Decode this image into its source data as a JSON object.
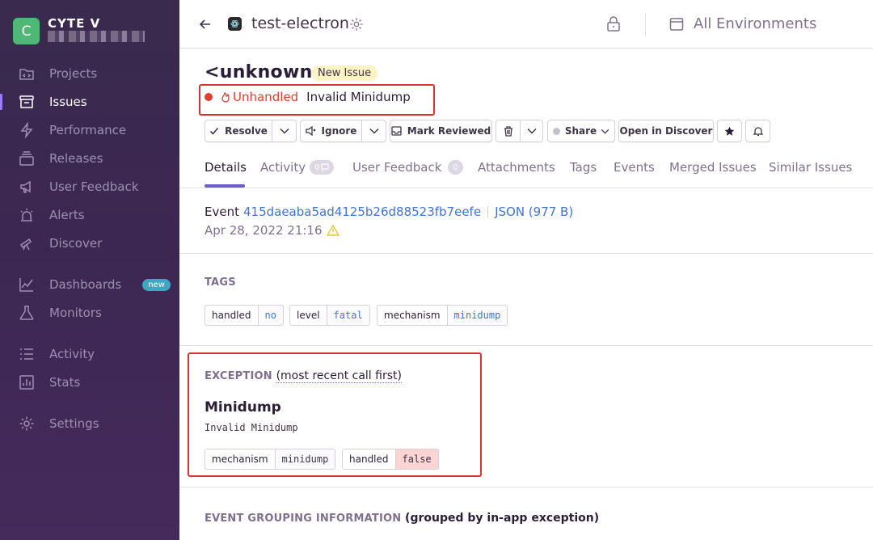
{
  "org": {
    "avatar_letter": "C",
    "name": "CYTE V"
  },
  "sidebar": {
    "items": [
      {
        "label": "Projects"
      },
      {
        "label": "Issues"
      },
      {
        "label": "Performance"
      },
      {
        "label": "Releases"
      },
      {
        "label": "User Feedback"
      },
      {
        "label": "Alerts"
      },
      {
        "label": "Discover"
      },
      {
        "label": "Dashboards",
        "badge": "new"
      },
      {
        "label": "Monitors"
      },
      {
        "label": "Activity"
      },
      {
        "label": "Stats"
      },
      {
        "label": "Settings"
      }
    ]
  },
  "header": {
    "project": "test-electron",
    "environment": "All Environments"
  },
  "issue": {
    "title": "<unknown>",
    "badge": "New Issue",
    "unhandled": "Unhandled",
    "message": "Invalid Minidump"
  },
  "actions": {
    "resolve": "Resolve",
    "ignore": "Ignore",
    "mark_reviewed": "Mark Reviewed",
    "share": "Share",
    "open_discover": "Open in Discover"
  },
  "tabs": [
    {
      "label": "Details"
    },
    {
      "label": "Activity",
      "count": "0"
    },
    {
      "label": "User Feedback",
      "count": "0"
    },
    {
      "label": "Attachments"
    },
    {
      "label": "Tags"
    },
    {
      "label": "Events"
    },
    {
      "label": "Merged Issues"
    },
    {
      "label": "Similar Issues"
    }
  ],
  "event": {
    "label": "Event",
    "id": "415daeaba5ad4125b26d88523fb7eefe",
    "json": "JSON (977 B)",
    "date": "Apr 28, 2022 21:16"
  },
  "tags_section": {
    "heading": "TAGS",
    "tags": [
      {
        "key": "handled",
        "value": "no"
      },
      {
        "key": "level",
        "value": "fatal"
      },
      {
        "key": "mechanism",
        "value": "minidump"
      }
    ]
  },
  "exception": {
    "heading": "EXCEPTION",
    "sub": "(most recent call first)",
    "type": "Minidump",
    "value": "Invalid Minidump",
    "mechanism_key": "mechanism",
    "mechanism_value": "minidump",
    "handled_key": "handled",
    "handled_value": "false"
  },
  "grouping": {
    "heading": "EVENT GROUPING INFORMATION",
    "sub": "(grouped by in-app exception)"
  },
  "colors": {
    "accent": "#6c5fc7",
    "error": "#e03e2f",
    "link": "#3d74db",
    "highlight": "#d9332f"
  }
}
